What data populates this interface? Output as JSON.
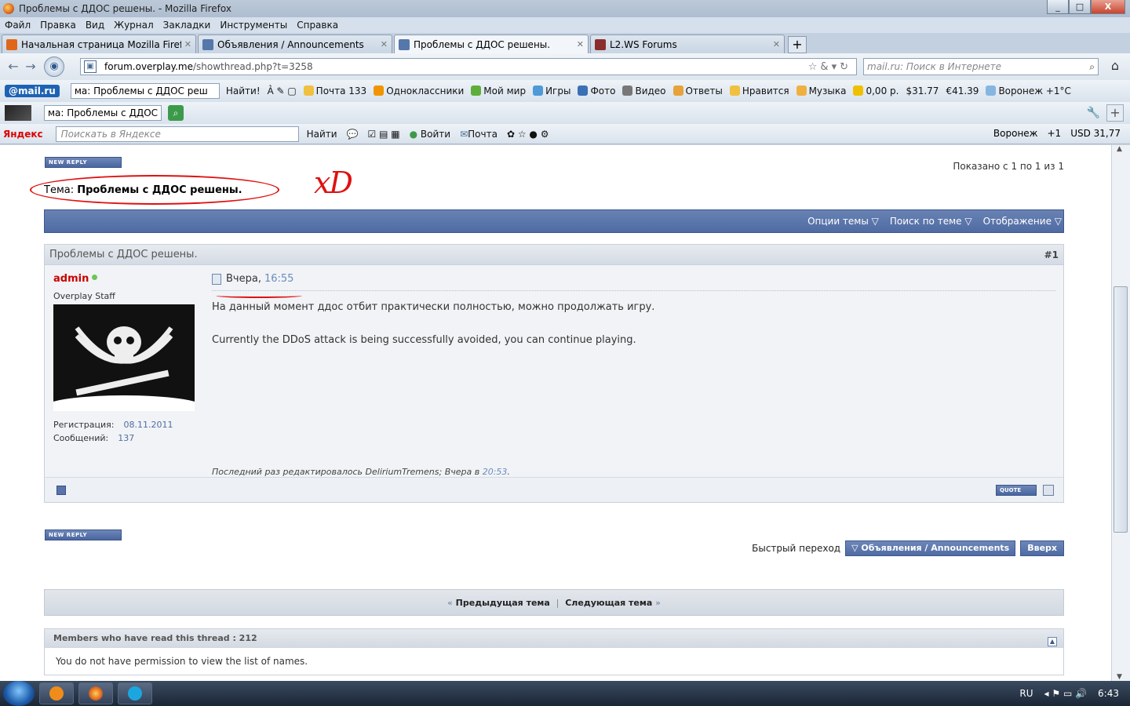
{
  "window": {
    "title": "Проблемы с ДДОС решены. - Mozilla Firefox",
    "min": "_",
    "max": "□",
    "close": "X"
  },
  "menu": [
    "Файл",
    "Правка",
    "Вид",
    "Журнал",
    "Закладки",
    "Инструменты",
    "Справка"
  ],
  "tabs": [
    {
      "label": "Начальная страница Mozilla Firefox",
      "color": "#e0661b"
    },
    {
      "label": "Объявления / Announcements",
      "color": "#5577aa"
    },
    {
      "label": "Проблемы с ДДОС решены.",
      "color": "#5577aa"
    },
    {
      "label": "L2.WS Forums",
      "color": "#8b2d2d"
    }
  ],
  "nav": {
    "url_host": "forum.overplay.me",
    "url_path": "/showthread.php?t=3258",
    "search_placeholder": "mail.ru: Поиск в Интернете"
  },
  "toolbar1": {
    "mailru": "@mail.ru",
    "search_value": "ма: Проблемы с ДДОС реш",
    "find": "Найти!",
    "items": [
      "Почта 133",
      "Одноклассники",
      "Мой мир",
      "Игры",
      "Фото",
      "Видео",
      "Ответы",
      "Нравится",
      "Музыка",
      "0,00 р.",
      "$31.77",
      "€41.39",
      "Воронеж +1°C"
    ]
  },
  "toolbar2": {
    "search_value": "ма: Проблемы с ДДОС"
  },
  "toolbar3": {
    "logo": "Яндекс",
    "placeholder": "Поискать в Яндексе",
    "find": "Найти",
    "login": "Войти",
    "mail": "Почта",
    "city": "Воронеж",
    "weather": "+1",
    "usd": "USD 31,77"
  },
  "page": {
    "new_reply": "NEW REPLY",
    "showing": "Показано с 1 по 1 из 1",
    "topic_prefix": "Тема:",
    "topic": "Проблемы с ДДОС решены.",
    "annotation": "xD",
    "bar": [
      "Опции темы ▽",
      "Поиск по теме ▽",
      "Отображение ▽"
    ],
    "post": {
      "title": "Проблемы с ДДОС решены.",
      "number": "#1",
      "user": "admin",
      "user_title": "Overplay Staff",
      "reg_label": "Регистрация:",
      "reg_value": "08.11.2011",
      "posts_label": "Сообщений:",
      "posts_value": "137",
      "date": "Вчера,",
      "time": "16:55",
      "text_ru": "На данный момент ддос отбит практически полностью, можно продолжать игру.",
      "text_en": "Currently the DDoS attack is being successfully avoided, you can continue playing.",
      "edited_prefix": "Последний раз редактировалось DeliriumTremens; Вчера в",
      "edited_time": "20:53",
      "edited_suffix": ".",
      "quote": "QUOTE"
    },
    "quick_jump": "Быстрый переход",
    "jump_target": "▽ Объявления / Announcements",
    "top": "Вверх",
    "prev": "Предыдущая тема",
    "next": "Следующая тема",
    "members_header": "Members who have read this thread : 212",
    "members_body": "You do not have permission to view the list of names."
  },
  "taskbar": {
    "lang": "RU",
    "time": "6:43"
  }
}
